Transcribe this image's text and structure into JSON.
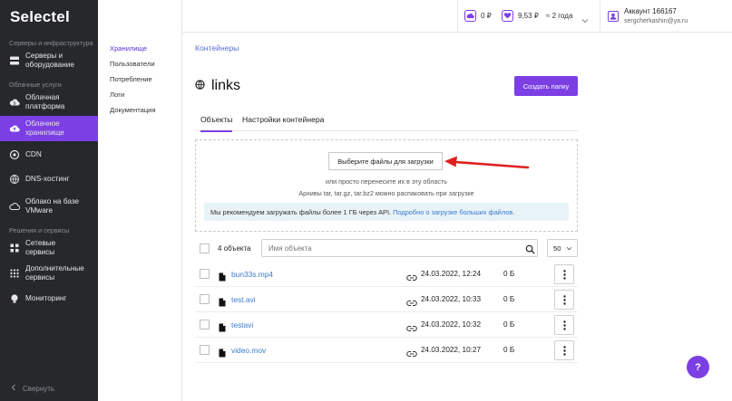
{
  "brand": "Selectel",
  "sidebar": {
    "section1": "Серверы и инфраструктура",
    "section2": "Облачные услуги",
    "section3": "Решения и сервисы",
    "items": [
      {
        "label": "Серверы и\nоборудование",
        "icon": "server-icon"
      },
      {
        "label": "Облачная\nплатформа",
        "icon": "cloud-platform-icon"
      },
      {
        "label": "Облачное\nхранилище",
        "icon": "cloud-upload-icon"
      },
      {
        "label": "CDN",
        "icon": "cdn-icon"
      },
      {
        "label": "DNS-хостинг",
        "icon": "dns-icon"
      },
      {
        "label": "Облако на базе\nVMware",
        "icon": "vmware-icon"
      },
      {
        "label": "Сетевые\nсервисы",
        "icon": "network-icon"
      },
      {
        "label": "Дополнительные\nсервисы",
        "icon": "grid-icon"
      },
      {
        "label": "Мониторинг",
        "icon": "bulb-icon"
      }
    ],
    "collapse_label": "Свернуть"
  },
  "subnav": [
    "Хранилище",
    "Пользователи",
    "Потребление",
    "Логи",
    "Документация"
  ],
  "topbar": {
    "balance1": "0 ₽",
    "balance2": "9,53 ₽",
    "forecast": "≈ 2 года",
    "account_name": "Аккаунт 166167",
    "account_email": "sergcherkashin@ya.ru"
  },
  "main": {
    "breadcrumb": "Контейнеры",
    "title": "links",
    "create_button": "Создать папку",
    "tabs": [
      "Объекты",
      "Настройки контейнера"
    ],
    "upload_button": "Выберите файлы для загрузки",
    "drop_hint": "или просто перенесите их в эту область",
    "archive_hint": "Архивы tar, tar.gz, tar.bz2 можно распаковать при загрузке",
    "info_text": "Мы рекомендуем загружать файлы более 1 ГБ через API.",
    "info_link": "Подробно о загрузке больших файлов.",
    "count": "4 объекта",
    "search_placeholder": "Имя объекта",
    "page_size": "50",
    "files": [
      {
        "name": "bun33s.mp4",
        "date": "24.03.2022, 12:24",
        "size": "0 Б"
      },
      {
        "name": "test.avi",
        "date": "24.03.2022, 10:33",
        "size": "0 Б"
      },
      {
        "name": "testavi",
        "date": "24.03.2022, 10:32",
        "size": "0 Б"
      },
      {
        "name": "video.mov",
        "date": "24.03.2022, 10:27",
        "size": "0 Б"
      }
    ]
  },
  "help": "?",
  "colors": {
    "accent": "#7b3fe4",
    "sidebar_bg": "#26282c",
    "link": "#3b7ad0",
    "annotation_arrow": "#e02020"
  }
}
